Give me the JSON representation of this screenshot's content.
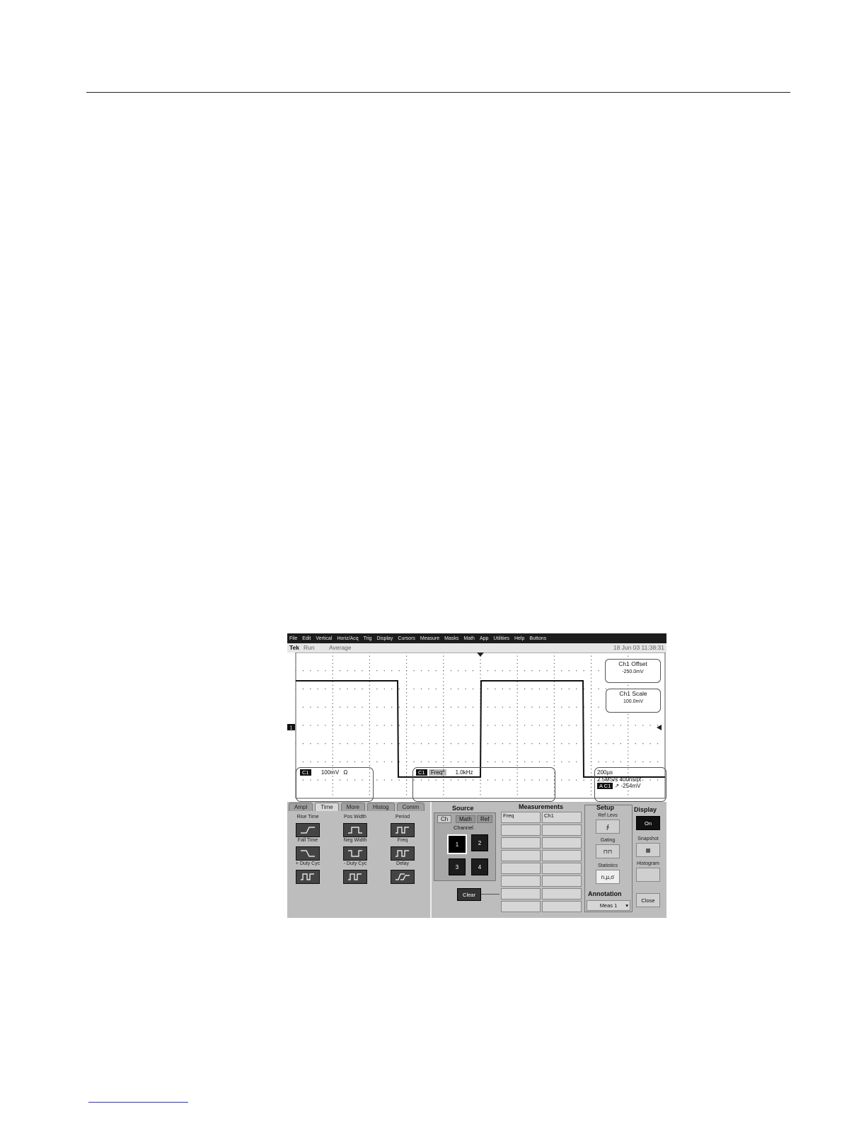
{
  "menu": [
    "File",
    "Edit",
    "Vertical",
    "Horiz/Acq",
    "Trig",
    "Display",
    "Cursors",
    "Measure",
    "Masks",
    "Math",
    "App",
    "Utilities",
    "Help",
    "Buttons"
  ],
  "status": {
    "brand": "Tek",
    "run": "Run",
    "acq": "Average",
    "datetime": "18 Jun 03 11:38:31"
  },
  "channel_marker": "1",
  "callouts": {
    "offset_title": "Ch1 Offset",
    "offset_value": "-250.0mV",
    "scale_title": "Ch1 Scale",
    "scale_value": "100.0mV"
  },
  "readouts": {
    "ch_tag": "C1",
    "ch_scale": "100mV",
    "ch_coupling": "Ω",
    "meas_tag": "C1",
    "meas_name": "Freq*",
    "meas_value": "1.0kHz",
    "timebase": "200µs",
    "sample_rate": "2.5MS/s 400ns/pt",
    "trig_tag": "A C1",
    "trig_level": "-254mV"
  },
  "tabs": [
    "Ampl",
    "Time",
    "More",
    "Histog",
    "Comm"
  ],
  "active_tab": "Time",
  "time_meas": [
    {
      "label": "Rise Time",
      "icon": "rise-time-icon"
    },
    {
      "label": "Pos Width",
      "icon": "pos-width-icon"
    },
    {
      "label": "Period",
      "icon": "period-icon"
    },
    {
      "label": "Fall Time",
      "icon": "fall-time-icon"
    },
    {
      "label": "Neg Width",
      "icon": "neg-width-icon"
    },
    {
      "label": "Freq",
      "icon": "freq-icon"
    },
    {
      "label": "+ Duty Cyc",
      "icon": "pos-duty-icon"
    },
    {
      "label": "- Duty Cyc",
      "icon": "neg-duty-icon"
    },
    {
      "label": "Delay",
      "icon": "delay-icon"
    }
  ],
  "source": {
    "title": "Source",
    "tabs": [
      "Ch",
      "Math",
      "Ref"
    ],
    "group": "Channel",
    "channels": [
      "1",
      "2",
      "3",
      "4"
    ],
    "selected": "1"
  },
  "clear_label": "Clear",
  "measurements": {
    "title": "Measurements",
    "rows": [
      [
        "Freq",
        "Ch1"
      ],
      [
        "",
        ""
      ],
      [
        "",
        ""
      ],
      [
        "",
        ""
      ],
      [
        "",
        ""
      ],
      [
        "",
        ""
      ],
      [
        "",
        ""
      ],
      [
        "",
        ""
      ]
    ]
  },
  "setup": {
    "title": "Setup",
    "ref_levs": "Ref Levs",
    "gating": "Gating",
    "statistics": "Statistics",
    "stats_icon": "n,µ,σ",
    "annotation": "Annotation",
    "annotation_value": "Meas 1"
  },
  "display": {
    "title": "Display",
    "on_label": "On",
    "snapshot": "Snapshot",
    "histogram": "Histogram",
    "close": "Close"
  },
  "waveform": {
    "frequency": "1.0kHz",
    "high": "+",
    "low": "-"
  }
}
